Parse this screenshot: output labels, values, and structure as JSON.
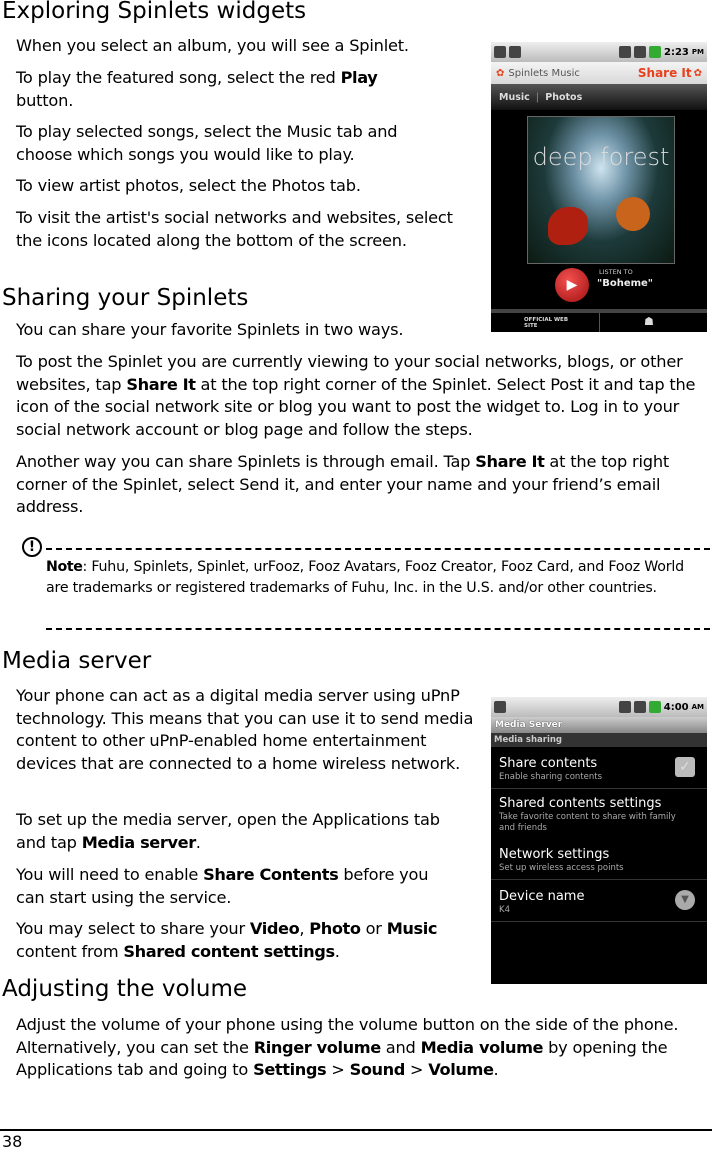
{
  "sections": [
    {
      "heading": "Exploring Spinlets widgets",
      "paragraphs": [
        [
          {
            "t": "When you select an album, you will see a Spinlet."
          }
        ],
        [
          {
            "t": "To play the featured song, select the red "
          },
          {
            "t": "Play",
            "b": true
          },
          {
            "t": " button."
          }
        ],
        [
          {
            "t": "To play selected songs, select the Music tab and choose which songs you would like to play."
          }
        ],
        [
          {
            "t": "To view artist photos, select the Photos tab."
          }
        ],
        [
          {
            "t": "To visit the artist's social networks and websites, select the icons located along the bottom of the screen."
          }
        ]
      ]
    },
    {
      "heading": "Sharing your Spinlets",
      "paragraphs": [
        [
          {
            "t": "You can share your favorite Spinlets in two ways."
          }
        ],
        [
          {
            "t": "To post the Spinlet you are currently viewing to your social networks, blogs, or other websites, tap "
          },
          {
            "t": "Share It",
            "b": true
          },
          {
            "t": " at the top right corner of the Spinlet. Select Post it and tap the icon of the social network site or blog you want to post the widget to. Log in to your social network account or blog page and follow the steps."
          }
        ],
        [
          {
            "t": "Another way you can share Spinlets is through email. Tap "
          },
          {
            "t": "Share It",
            "b": true
          },
          {
            "t": " at the top right corner of the Spinlet, select Send it, and enter your name and your friend’s email address."
          }
        ]
      ]
    },
    {
      "heading": "Media server",
      "paragraphs": [
        [
          {
            "t": "Your phone can act as a digital media server using uPnP technology. This means that you can use it to send media content to other uPnP-enabled home entertainment devices that are connected to a home wireless network."
          }
        ],
        [
          {
            "t": "To set up the media server, open the Applications tab and tap "
          },
          {
            "t": "Media server",
            "b": true
          },
          {
            "t": "."
          }
        ],
        [
          {
            "t": "You will need to enable "
          },
          {
            "t": "Share Contents",
            "b": true
          },
          {
            "t": " before you can start using the service."
          }
        ],
        [
          {
            "t": "You may select to share your "
          },
          {
            "t": "Video",
            "b": true
          },
          {
            "t": ", "
          },
          {
            "t": "Photo",
            "b": true
          },
          {
            "t": " or "
          },
          {
            "t": "Music",
            "b": true
          },
          {
            "t": " content from "
          },
          {
            "t": "Shared content settings",
            "b": true
          },
          {
            "t": "."
          }
        ]
      ]
    },
    {
      "heading": "Adjusting the volume",
      "paragraphs": [
        [
          {
            "t": "Adjust the volume of your phone using the volume button on the side of the phone. Alternatively, you can set the "
          },
          {
            "t": "Ringer volume",
            "b": true
          },
          {
            "t": " and "
          },
          {
            "t": "Media volume",
            "b": true
          },
          {
            "t": " by opening the Applications tab and going to "
          },
          {
            "t": "Settings",
            "b": true
          },
          {
            "t": " > "
          },
          {
            "t": "Sound",
            "b": true
          },
          {
            "t": " > "
          },
          {
            "t": "Volume",
            "b": true
          },
          {
            "t": "."
          }
        ]
      ]
    }
  ],
  "note": {
    "icon": "exclamation-circle-icon",
    "runs": [
      {
        "t": "Note",
        "b": true
      },
      {
        "t": ": Fuhu, Spinlets, Spinlet, urFooz, Fooz Avatars, Fooz Creator, Fooz Card, and Fooz World are trademarks or registered trademarks of Fuhu, Inc. in the U.S. and/or other countries."
      }
    ]
  },
  "spinlet_screenshot": {
    "time": "2:23",
    "ampm": "PM",
    "app_name": "Spinlets Music",
    "share_label": "Share It",
    "tabs": [
      "Music",
      "Photos"
    ],
    "album_text": "deep forest",
    "listen_to": "LISTEN TO",
    "song": "\"Boheme\"",
    "official_site": "OFFICIAL WEB SITE",
    "accent": "#e8401c"
  },
  "media_screenshot": {
    "time": "4:00",
    "ampm": "AM",
    "title": "Media Server",
    "section": "Media sharing",
    "items": [
      {
        "title": "Share contents",
        "sub": "Enable sharing contents",
        "control": "checkbox"
      },
      {
        "title": "Shared contents settings",
        "sub": "Take favorite content to share with family and friends"
      },
      {
        "title": "Network settings",
        "sub": "Set up wireless access points"
      },
      {
        "title": "Device name",
        "sub": "K4",
        "control": "dropdown"
      }
    ]
  },
  "footer": {
    "page_number": "38"
  }
}
